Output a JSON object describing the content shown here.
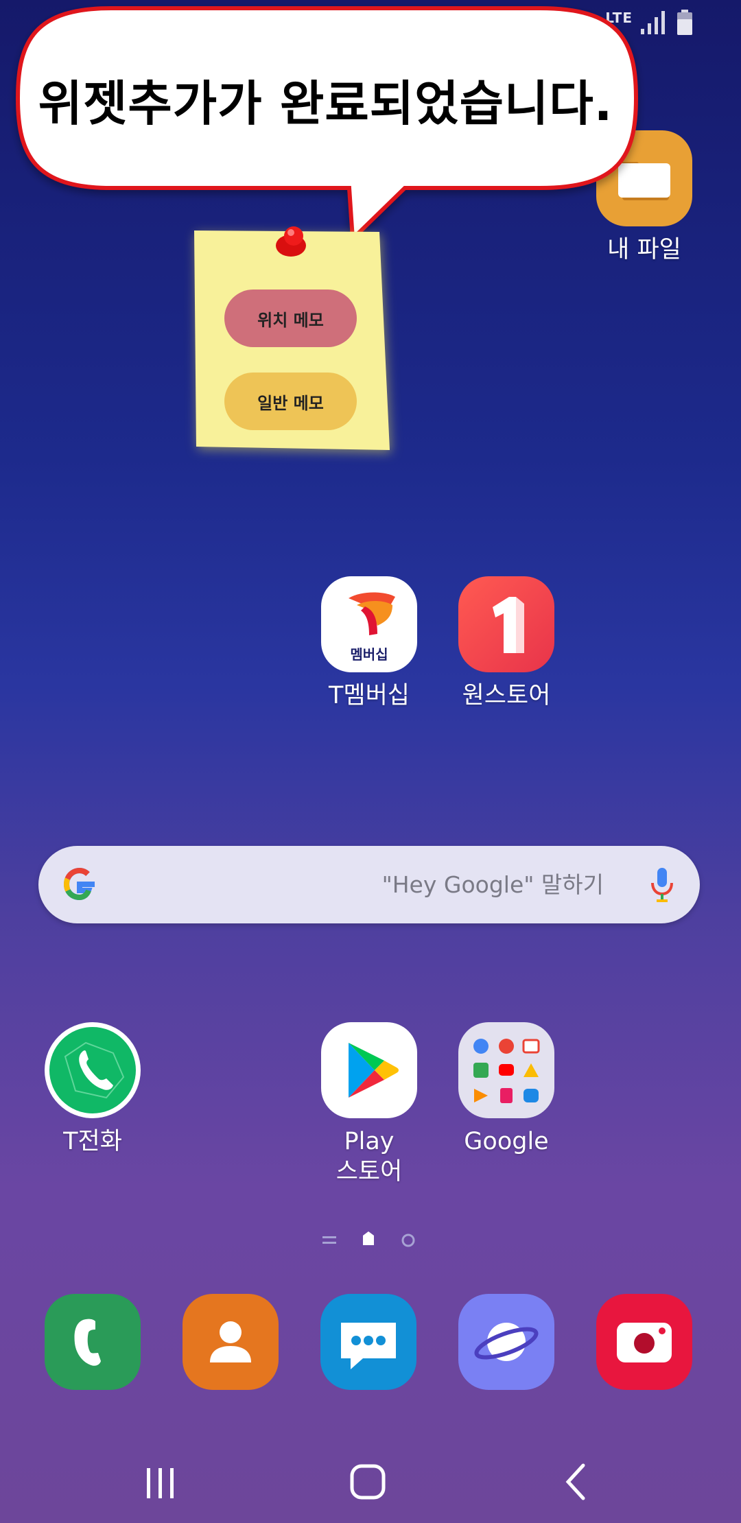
{
  "status_bar": {
    "network": "LTE"
  },
  "toast": {
    "message": "위젯추가가 완료되었습니다."
  },
  "memo_widget": {
    "location_memo": "위치 메모",
    "general_memo": "일반 메모"
  },
  "apps": {
    "my_files": "내 파일",
    "t_membership": "T멤버십",
    "t_membership_badge": "멤버십",
    "onestore": "원스토어",
    "t_phone": "T전화",
    "play_store": "Play\n스토어",
    "google": "Google"
  },
  "search": {
    "placeholder": "\"Hey Google\" 말하기"
  },
  "dock": [
    "phone-icon",
    "contacts-icon",
    "messages-icon",
    "internet-icon",
    "camera-icon"
  ],
  "colors": {
    "bubble_border": "#e0141b",
    "memo_paper": "#f8f19a",
    "location_memo_button": "#cf6f7a",
    "general_memo_button": "#eec456"
  }
}
